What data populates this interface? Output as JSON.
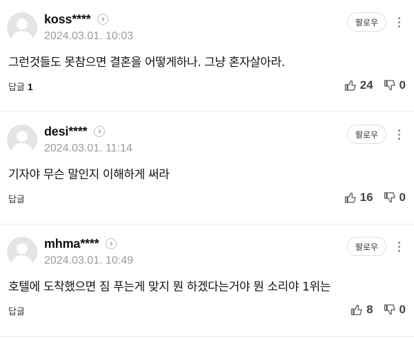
{
  "comments": [
    {
      "nickname": "koss****",
      "date": "2024.03.01. 10:03",
      "follow_label": "팔로우",
      "content": "그런것들도 못참으면 결혼을 어떻게하나. 그냥 혼자살아라.",
      "reply_label": "답글",
      "reply_count": "1",
      "likes": "24",
      "dislikes": "0"
    },
    {
      "nickname": "desi****",
      "date": "2024.03.01. 11:14",
      "follow_label": "팔로우",
      "content": "기자야 무슨 말인지 이해하게 써라",
      "reply_label": "답글",
      "reply_count": "",
      "likes": "16",
      "dislikes": "0"
    },
    {
      "nickname": "mhma****",
      "date": "2024.03.01. 10:49",
      "follow_label": "팔로우",
      "content": "호텔에 도착했으면 짐 푸는게 맞지 뭔 하겠다는거야 뭔 소리야 1위는",
      "reply_label": "답글",
      "reply_count": "",
      "likes": "8",
      "dislikes": "0"
    }
  ]
}
